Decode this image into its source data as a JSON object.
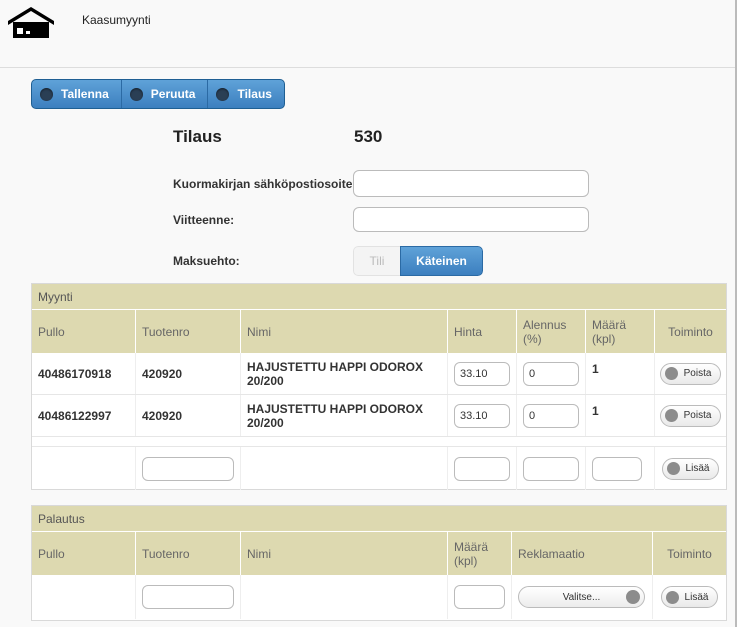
{
  "app": {
    "title": "Kaasumyynti",
    "logo_icon": "warehouse-icon"
  },
  "toolbar": {
    "buttons": [
      {
        "label": "Tallenna"
      },
      {
        "label": "Peruuta"
      },
      {
        "label": "Tilaus"
      }
    ]
  },
  "order": {
    "label": "Tilaus",
    "number": "530",
    "fields": {
      "email_label": "Kuormakirjan sähköpostiosoite",
      "email_value": "",
      "reference_label": "Viitteenne:",
      "reference_value": "",
      "payment_label": "Maksuehto:",
      "payment_options": [
        "Tili",
        "Käteinen"
      ],
      "payment_selected": "Käteinen"
    }
  },
  "sales": {
    "title": "Myynti",
    "columns": [
      "Pullo",
      "Tuotenro",
      "Nimi",
      "Hinta",
      "Alennus (%)",
      "Määrä (kpl)",
      "Toiminto"
    ],
    "rows": [
      {
        "pullo": "40486170918",
        "tuotenro": "420920",
        "nimi": "HAJUSTETTU HAPPI ODOROX 20/200",
        "hinta": "33.10",
        "alennus": "0",
        "maara": "1",
        "action": "Poista"
      },
      {
        "pullo": "40486122997",
        "tuotenro": "420920",
        "nimi": "HAJUSTETTU HAPPI ODOROX 20/200",
        "hinta": "33.10",
        "alennus": "0",
        "maara": "1",
        "action": "Poista"
      }
    ],
    "add_action": "Lisää"
  },
  "returns": {
    "title": "Palautus",
    "columns": [
      "Pullo",
      "Tuotenro",
      "Nimi",
      "Määrä (kpl)",
      "Reklamaatio",
      "Toiminto"
    ],
    "select_placeholder": "Valitse...",
    "add_action": "Lisää"
  }
}
